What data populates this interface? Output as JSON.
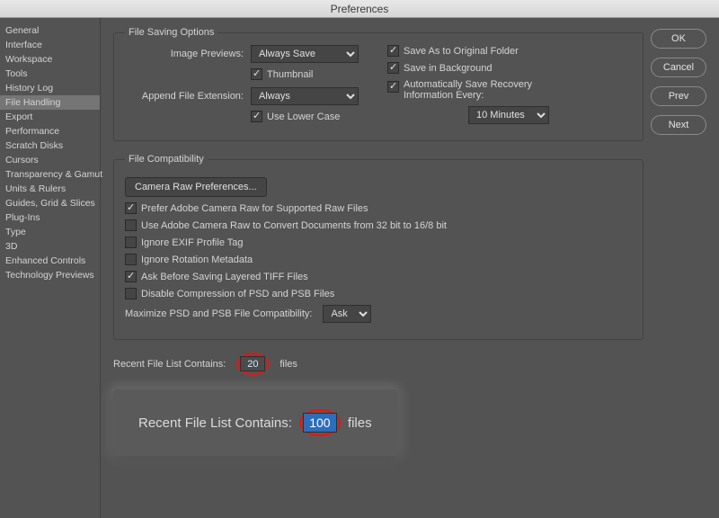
{
  "titlebar": "Preferences",
  "sidebar": {
    "items": [
      "General",
      "Interface",
      "Workspace",
      "Tools",
      "History Log",
      "File Handling",
      "Export",
      "Performance",
      "Scratch Disks",
      "Cursors",
      "Transparency & Gamut",
      "Units & Rulers",
      "Guides, Grid & Slices",
      "Plug-Ins",
      "Type",
      "3D",
      "Enhanced Controls",
      "Technology Previews"
    ],
    "selectedIndex": 5
  },
  "buttons": {
    "ok": "OK",
    "cancel": "Cancel",
    "prev": "Prev",
    "next": "Next"
  },
  "fileSaving": {
    "legend": "File Saving Options",
    "imagePreviewsLabel": "Image Previews:",
    "imagePreviewsValue": "Always Save",
    "thumbnail": "Thumbnail",
    "appendLabel": "Append File Extension:",
    "appendValue": "Always",
    "useLowerCase": "Use Lower Case",
    "saveAsOriginal": "Save As to Original Folder",
    "saveInBackground": "Save in Background",
    "autoSave": "Automatically Save Recovery Information Every:",
    "autoSaveInterval": "10 Minutes"
  },
  "compat": {
    "legend": "File Compatibility",
    "cameraRawBtn": "Camera Raw Preferences...",
    "preferRaw": "Prefer Adobe Camera Raw for Supported Raw Files",
    "convert32": "Use Adobe Camera Raw to Convert Documents from 32 bit to 16/8 bit",
    "ignoreExif": "Ignore EXIF Profile Tag",
    "ignoreRotation": "Ignore Rotation Metadata",
    "askTiff": "Ask Before Saving Layered TIFF Files",
    "disablePsd": "Disable Compression of PSD and PSB Files",
    "maxPsdLabel": "Maximize PSD and PSB File Compatibility:",
    "maxPsdValue": "Ask"
  },
  "recent": {
    "label": "Recent File List Contains:",
    "value": "20",
    "suffix": "files",
    "bigValue": "100"
  }
}
